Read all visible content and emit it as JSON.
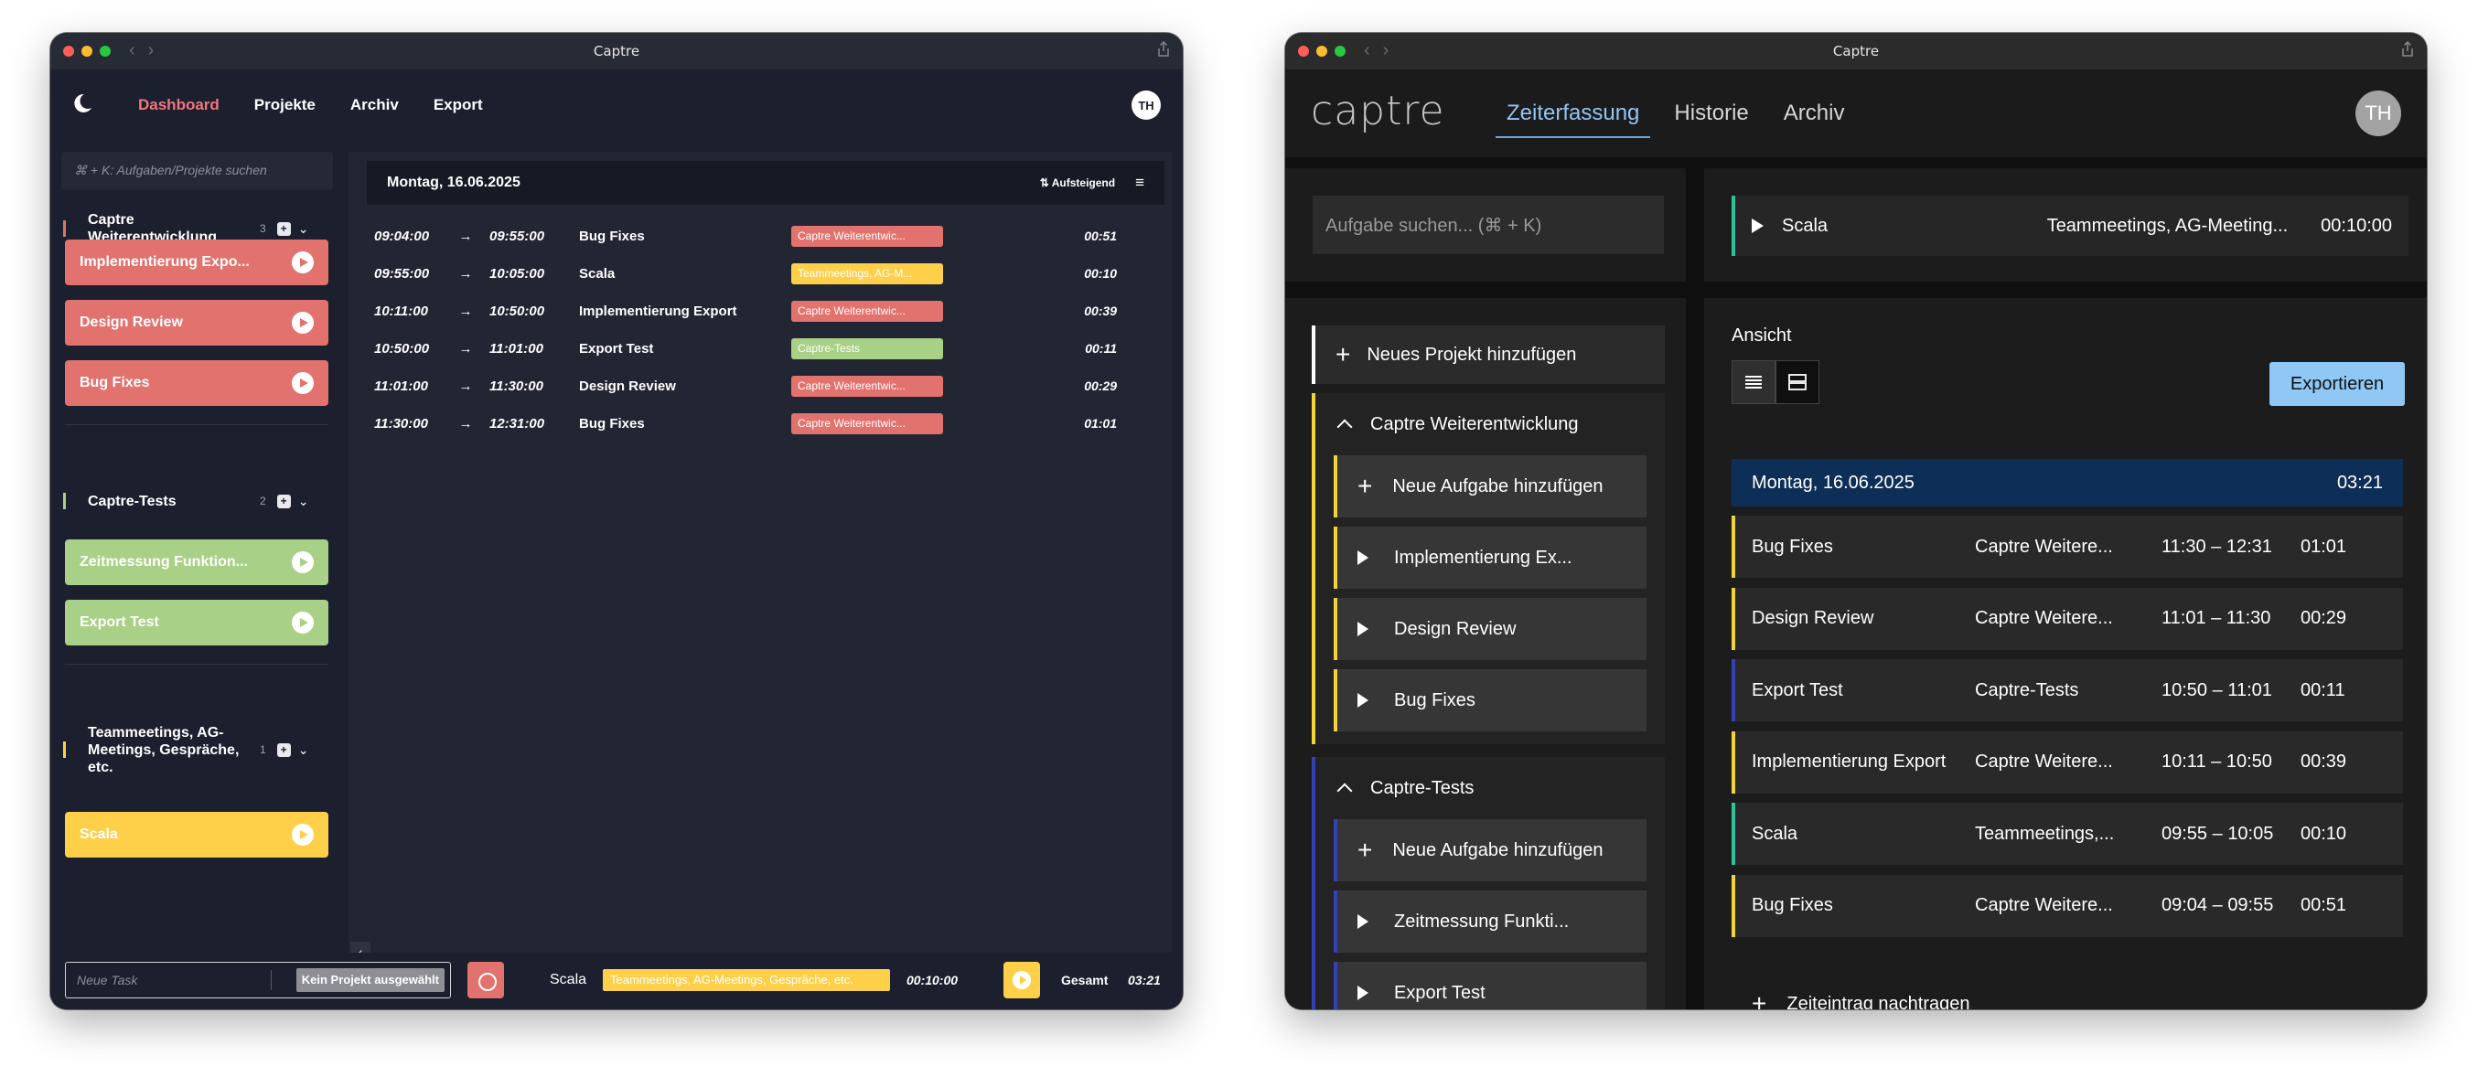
{
  "colors": {
    "red": "#e2726e",
    "yellow": "#fed04a",
    "green": "#a8d086",
    "b_yellow": "#f2d43a",
    "b_blue": "#3242b4",
    "b_teal": "#31c29a",
    "b_accent": "#90c8f5"
  },
  "window_a": {
    "title": "Captre",
    "nav": {
      "items": [
        {
          "label": "Dashboard",
          "active": true
        },
        {
          "label": "Projekte",
          "active": false
        },
        {
          "label": "Archiv",
          "active": false
        },
        {
          "label": "Export",
          "active": false
        }
      ],
      "avatar": "TH"
    },
    "sidebar": {
      "search_placeholder": "⌘ + K: Aufgaben/Projekte suchen",
      "groups": [
        {
          "name": "Captre Weiterentwicklung",
          "count": "3",
          "color": "red",
          "tasks": [
            "Implementierung Expo...",
            "Design Review",
            "Bug Fixes"
          ]
        },
        {
          "name": "Captre-Tests",
          "count": "2",
          "color": "green",
          "tasks": [
            "Zeitmessung Funktion...",
            "Export Test"
          ]
        },
        {
          "name": "Teammeetings, AG-Meetings, Gespräche, etc.",
          "count": "1",
          "color": "yellow",
          "tasks": [
            "Scala"
          ]
        }
      ]
    },
    "main": {
      "day": "Montag, 16.06.2025",
      "sort_label": "Aufsteigend",
      "entries": [
        {
          "start": "09:04:00",
          "end": "09:55:00",
          "name": "Bug Fixes",
          "tag": "Captre Weiterentwic...",
          "tag_color": "red",
          "duration": "00:51"
        },
        {
          "start": "09:55:00",
          "end": "10:05:00",
          "name": "Scala",
          "tag": "Teammeetings, AG-M...",
          "tag_color": "yellow",
          "duration": "00:10"
        },
        {
          "start": "10:11:00",
          "end": "10:50:00",
          "name": "Implementierung Export",
          "tag": "Captre Weiterentwic...",
          "tag_color": "red",
          "duration": "00:39"
        },
        {
          "start": "10:50:00",
          "end": "11:01:00",
          "name": "Export Test",
          "tag": "Captre-Tests",
          "tag_color": "green",
          "duration": "00:11"
        },
        {
          "start": "11:01:00",
          "end": "11:30:00",
          "name": "Design Review",
          "tag": "Captre Weiterentwic...",
          "tag_color": "red",
          "duration": "00:29"
        },
        {
          "start": "11:30:00",
          "end": "12:31:00",
          "name": "Bug Fixes",
          "tag": "Captre Weiterentwic...",
          "tag_color": "red",
          "duration": "01:01"
        }
      ]
    },
    "footer": {
      "task_placeholder": "Neue Task",
      "no_project": "Kein Projekt ausgewählt",
      "current_name": "Scala",
      "current_tag": "Teammeetings, AG-Meetings, Gespräche, etc.",
      "current_time": "00:10:00",
      "total_label": "Gesamt",
      "total": "03:21"
    }
  },
  "window_b": {
    "title": "Captre",
    "logo": "captre",
    "nav": {
      "items": [
        {
          "label": "Zeiterfassung",
          "active": true
        },
        {
          "label": "Historie",
          "active": false
        },
        {
          "label": "Archiv",
          "active": false
        }
      ],
      "avatar": "TH"
    },
    "search_placeholder": "Aufgabe suchen... (⌘ + K)",
    "running": {
      "name": "Scala",
      "project": "Teammeetings, AG-Meeting...",
      "time": "00:10:00"
    },
    "add_project": "Neues Projekt hinzufügen",
    "projects": [
      {
        "name": "Captre Weiterentwicklung",
        "color": "b_yellow",
        "add_task": "Neue Aufgabe hinzufügen",
        "tasks": [
          "Implementierung Ex...",
          "Design Review",
          "Bug Fixes"
        ]
      },
      {
        "name": "Captre-Tests",
        "color": "b_blue",
        "add_task": "Neue Aufgabe hinzufügen",
        "tasks": [
          "Zeitmessung Funkti...",
          "Export Test"
        ]
      }
    ],
    "view_label": "Ansicht",
    "export_label": "Exportieren",
    "day": "Montag, 16.06.2025",
    "day_total": "03:21",
    "entries": [
      {
        "name": "Bug Fixes",
        "project": "Captre Weitere...",
        "start": "11:30",
        "end": "12:31",
        "duration": "01:01",
        "color": "b_yellow"
      },
      {
        "name": "Design Review",
        "project": "Captre Weitere...",
        "start": "11:01",
        "end": "11:30",
        "duration": "00:29",
        "color": "b_yellow"
      },
      {
        "name": "Export Test",
        "project": "Captre-Tests",
        "start": "10:50",
        "end": "11:01",
        "duration": "00:11",
        "color": "b_blue"
      },
      {
        "name": "Implementierung Export",
        "project": "Captre Weitere...",
        "start": "10:11",
        "end": "10:50",
        "duration": "00:39",
        "color": "b_yellow"
      },
      {
        "name": "Scala",
        "project": "Teammeetings,...",
        "start": "09:55",
        "end": "10:05",
        "duration": "00:10",
        "color": "b_teal"
      },
      {
        "name": "Bug Fixes",
        "project": "Captre Weitere...",
        "start": "09:04",
        "end": "09:55",
        "duration": "00:51",
        "color": "b_yellow"
      }
    ],
    "add_entry": "Zeiteintrag nachtragen"
  }
}
